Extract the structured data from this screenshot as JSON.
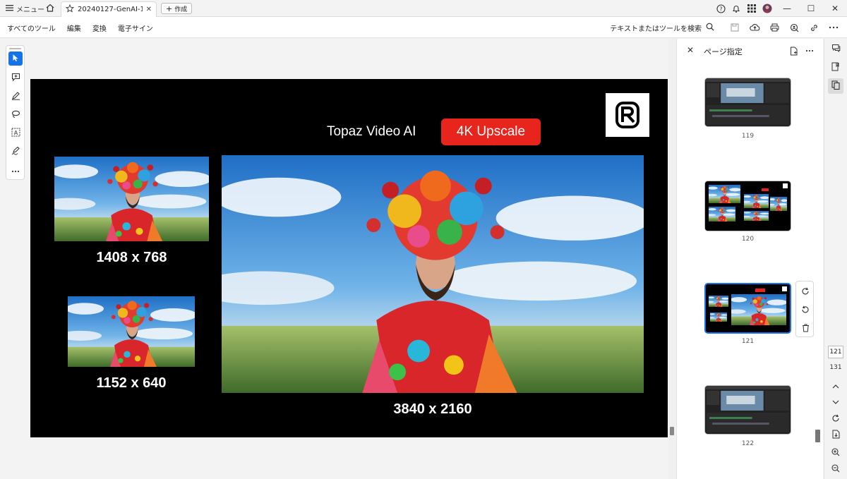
{
  "titlebar": {
    "menu_label": "メニュー",
    "tab_title": "20240127-GenAI-10...",
    "new_tab_label": "作成",
    "window_controls": [
      "minimize-icon",
      "maximize-icon",
      "close-icon"
    ]
  },
  "menubar": {
    "items": [
      "すべてのツール",
      "編集",
      "変換",
      "電子サイン"
    ],
    "search_label": "テキストまたはツールを検索"
  },
  "slide": {
    "title": "Topaz Video AI",
    "badge": "4K Upscale",
    "badge_color": "#e8251c",
    "labels": {
      "small_top": "1408 x 768",
      "small_bottom": "1152 x 640",
      "large": "3840 x 2160"
    }
  },
  "pane": {
    "title": "ページ指定",
    "pages": [
      "119",
      "120",
      "121",
      "122"
    ],
    "selected_page": "121"
  },
  "rail": {
    "current_page": "121",
    "total_pages": "131"
  },
  "colors": {
    "accent": "#1473e6"
  }
}
